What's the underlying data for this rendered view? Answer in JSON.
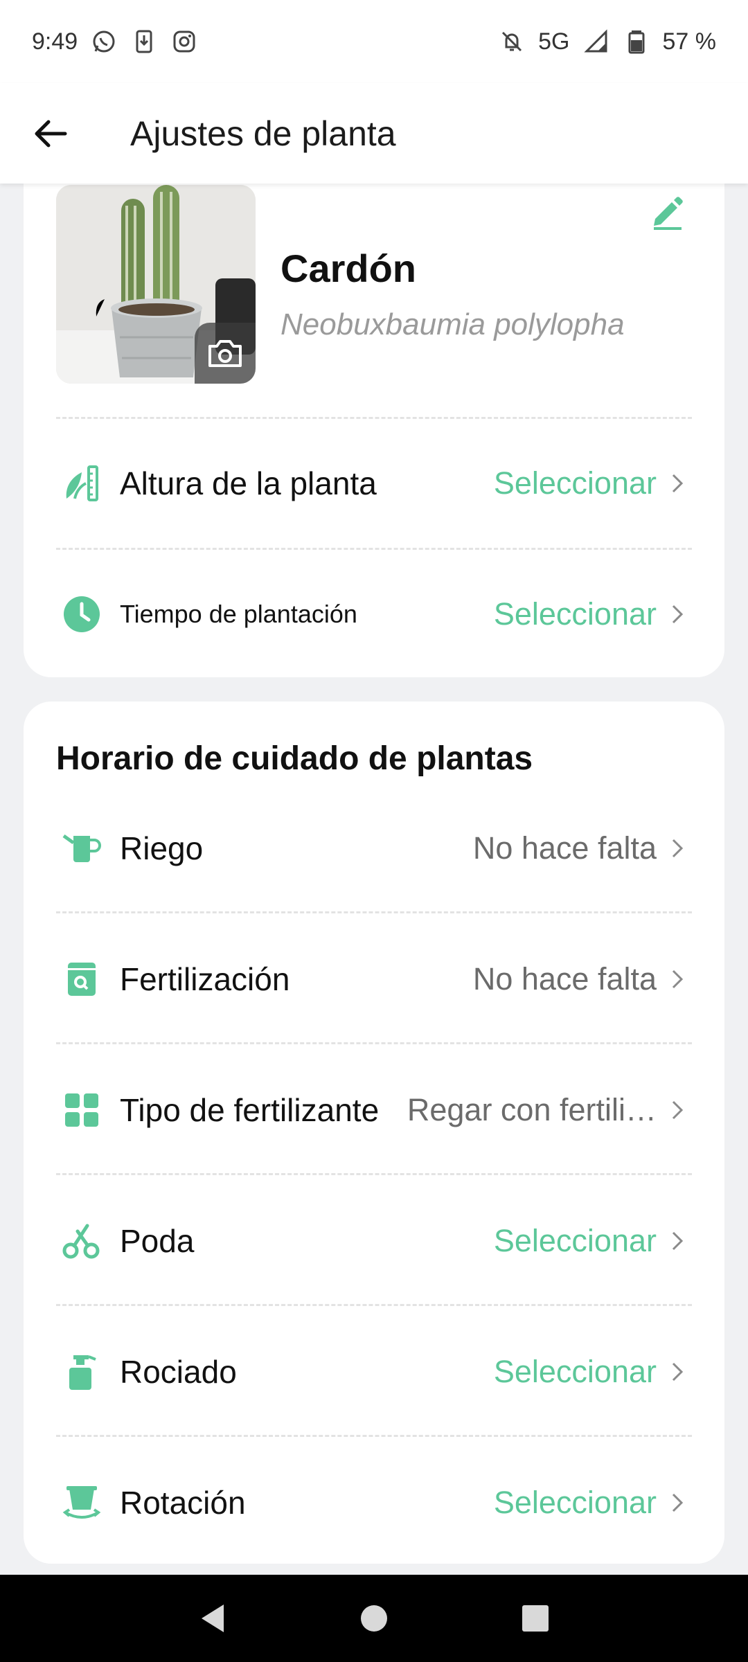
{
  "status_bar": {
    "time": "9:49",
    "network": "5G",
    "battery": "57 %"
  },
  "app_bar": {
    "title": "Ajustes de planta"
  },
  "plant": {
    "name": "Cardón",
    "scientific_name": "Neobuxbaumia polylopha",
    "rows": [
      {
        "label": "Altura de la planta",
        "value": "Seleccionar",
        "icon": "plant-height-icon"
      },
      {
        "label": "Tiempo de plantación",
        "value": "Seleccionar",
        "icon": "clock-icon"
      }
    ]
  },
  "care": {
    "title": "Horario de cuidado de plantas",
    "rows": [
      {
        "label": "Riego",
        "value": "No hace falta",
        "icon": "watering-can-icon"
      },
      {
        "label": "Fertilización",
        "value": "No hace falta",
        "icon": "fertilizer-bag-icon"
      },
      {
        "label": "Tipo de fertilizante",
        "value": "Regar con fertili…",
        "icon": "grid-icon"
      },
      {
        "label": "Poda",
        "value": "Seleccionar",
        "icon": "scissors-icon"
      },
      {
        "label": "Rociado",
        "value": "Seleccionar",
        "icon": "spray-bottle-icon"
      },
      {
        "label": "Rotación",
        "value": "Seleccionar",
        "icon": "rotate-pot-icon"
      }
    ]
  },
  "colors": {
    "accent": "#5cc799",
    "value_gray": "#6b6b6b",
    "background": "#f0f1f3"
  }
}
